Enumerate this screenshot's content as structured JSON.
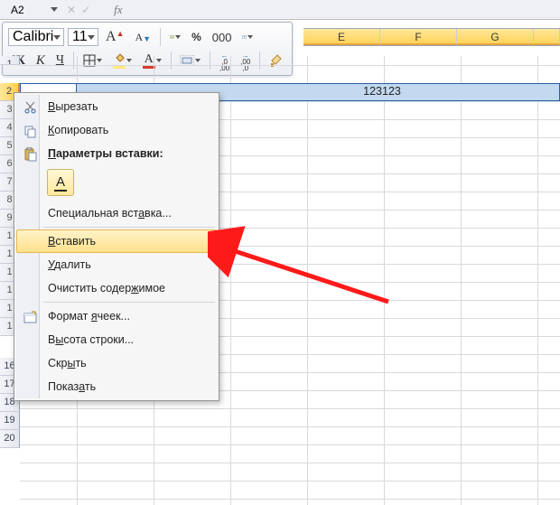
{
  "namebox": {
    "cell": "A2",
    "fx_label": "fx"
  },
  "minitoolbar": {
    "font_name": "Calibri",
    "font_size": "11",
    "grow_glyph": "A",
    "shrink_glyph": "A",
    "percent": "%",
    "thousands": "000",
    "bold": "Ж",
    "italic": "К",
    "underline": "Ч",
    "fontcolor_glyph": "A",
    "incdec_left": ",0",
    "incdec_left2": ",00",
    "incdec_right": ",00",
    "incdec_right2": ",0"
  },
  "columns": [
    "E",
    "F",
    "G"
  ],
  "row_numbers_top": [
    "1",
    "2"
  ],
  "row_numbers_under_menu": [
    "3",
    "4",
    "5",
    "6",
    "7",
    "8",
    "9",
    "1",
    "1",
    "1",
    "1",
    "1",
    "1"
  ],
  "row_numbers_bottom": [
    "16",
    "17",
    "18",
    "19",
    "20"
  ],
  "grid": {
    "row2_value": "123123"
  },
  "context_menu": {
    "cut": {
      "pre": "",
      "u": "В",
      "post": "ырезать"
    },
    "copy": {
      "pre": "",
      "u": "К",
      "post": "опировать"
    },
    "paste_opts": {
      "pre": "",
      "u": "П",
      "post": "араметры вставки:"
    },
    "paste_chip": "A",
    "paste_special": {
      "pre": "Специальная вст",
      "u": "а",
      "post": "вка..."
    },
    "insert": {
      "pre": "",
      "u": "В",
      "post": "ставить"
    },
    "delete": {
      "pre": "",
      "u": "У",
      "post": "далить"
    },
    "clear": {
      "pre": "Очистить содер",
      "u": "ж",
      "post": "имое"
    },
    "format": {
      "pre": "Формат ",
      "u": "я",
      "post": "чеек..."
    },
    "row_height": {
      "pre": "В",
      "u": "ы",
      "post": "сота строки..."
    },
    "hide": {
      "pre": "Скр",
      "u": "ы",
      "post": "ть"
    },
    "show": {
      "pre": "Показ",
      "u": "а",
      "post": "ть"
    }
  }
}
